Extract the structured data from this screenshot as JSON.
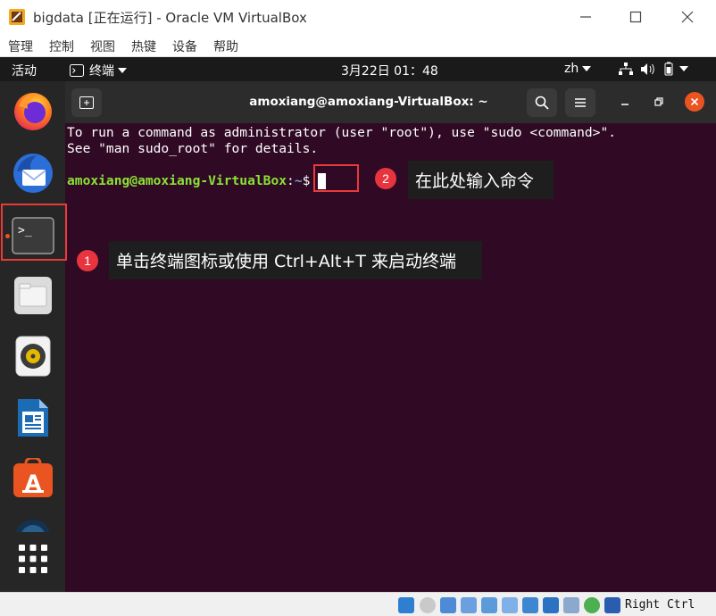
{
  "window": {
    "title": "bigdata [正在运行] - Oracle VM VirtualBox",
    "menu": [
      "管理",
      "控制",
      "视图",
      "热键",
      "设备",
      "帮助"
    ]
  },
  "topbar": {
    "activities": "活动",
    "app_menu": "终端",
    "clock": "3月22日  01：48",
    "input_method": "zh"
  },
  "dock": {
    "items": [
      "firefox-icon",
      "thunderbird-icon",
      "terminal-icon",
      "files-icon",
      "rhythmbox-icon",
      "libreoffice-writer-icon",
      "ubuntu-software-icon",
      "help-icon",
      "show-apps-icon"
    ]
  },
  "terminal": {
    "title": "amoxiang@amoxiang-VirtualBox: ~",
    "lines": [
      "To run a command as administrator (user \"root\"), use \"sudo <command>\".",
      "See \"man sudo_root\" for details."
    ],
    "prompt_user": "amoxiang@amoxiang-VirtualBox",
    "prompt_sep": ":",
    "prompt_path": "~",
    "prompt_symbol": "$"
  },
  "annotations": {
    "step1_number": "1",
    "step1_text": "单击终端图标或使用 Ctrl+Alt+T 来启动终端",
    "step2_number": "2",
    "step2_text": "在此处输入命令"
  },
  "statusbar": {
    "host_key": "Right Ctrl"
  },
  "colors": {
    "terminal_bg": "#300a24",
    "accent": "#e95420",
    "annotation_red": "#ea3a3a",
    "prompt_green": "#8ae234",
    "prompt_blue": "#729fcf"
  }
}
